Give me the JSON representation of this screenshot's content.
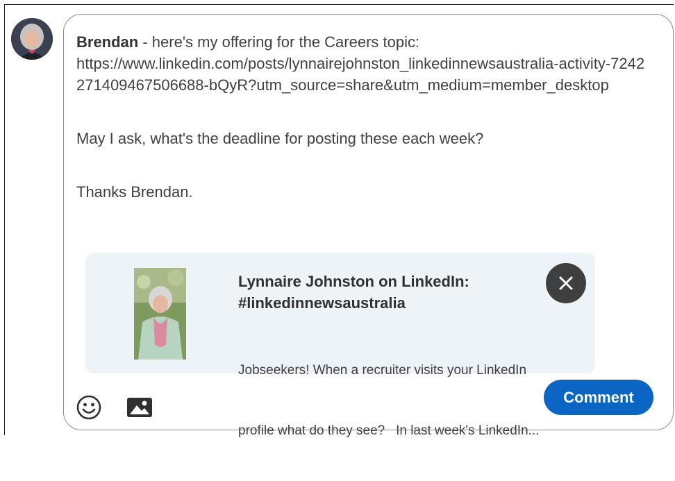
{
  "author": {
    "avatar_icon": "user-avatar-photo"
  },
  "comment": {
    "mention": "Brendan",
    "line1_rest": " - here's my offering for the Careers topic:",
    "link": "https://www.linkedin.com/posts/lynnairejohnston_linkedinnewsaustralia-activity-7242271409467506688-bQyR?utm_source=share&utm_medium=member_desktop",
    "paragraph2": "May I ask, what's the deadline for posting these each week?",
    "paragraph3": "Thanks Brendan."
  },
  "link_preview": {
    "title_line1": "Lynnaire Johnston on LinkedIn:",
    "title_line2": "#linkedinnewsaustralia",
    "desc_line1": "Jobseekers! When a recruiter visits your LinkedIn",
    "desc_line2": "profile what do they see?   In last week's LinkedIn...",
    "close_icon": "close-icon"
  },
  "toolbar": {
    "emoji_icon": "emoji-smile-icon",
    "image_icon": "image-icon",
    "comment_label": "Comment"
  },
  "colors": {
    "accent": "#0a66c2",
    "preview_bg": "#eef3f8",
    "close_bg": "#3f3f3f"
  }
}
